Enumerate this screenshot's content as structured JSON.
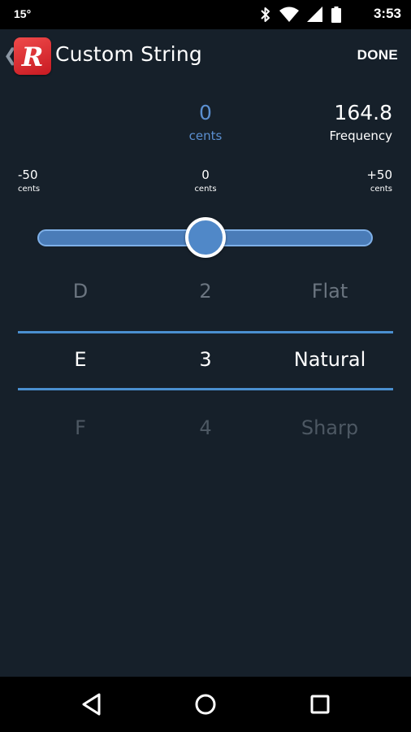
{
  "status_bar": {
    "temperature": "15°",
    "time": "3:53"
  },
  "app_bar": {
    "title": "Custom String",
    "done_label": "DONE",
    "logo_letter": "R"
  },
  "readouts": {
    "cents_value": "0",
    "cents_unit": "cents",
    "frequency_value": "164.8",
    "frequency_unit": "Frequency"
  },
  "scale": {
    "min_value": "-50",
    "min_unit": "cents",
    "mid_value": "0",
    "mid_unit": "cents",
    "max_value": "+50",
    "max_unit": "cents"
  },
  "slider": {
    "value": 0,
    "min": -50,
    "max": 50
  },
  "pickers": {
    "note": {
      "prev": "D",
      "selected": "E",
      "next": "F"
    },
    "octave": {
      "prev": "2",
      "selected": "3",
      "next": "4"
    },
    "accidental": {
      "prev": "Flat",
      "selected": "Natural",
      "next": "Sharp"
    }
  },
  "colors": {
    "background": "#16202a",
    "accent": "#4a8fcf",
    "logo": "#d8262e"
  },
  "icons": {
    "status": [
      "bluetooth-icon",
      "wifi-icon",
      "cell-signal-icon",
      "battery-icon"
    ],
    "nav": [
      "back-triangle-icon",
      "home-circle-icon",
      "recents-square-icon"
    ]
  }
}
